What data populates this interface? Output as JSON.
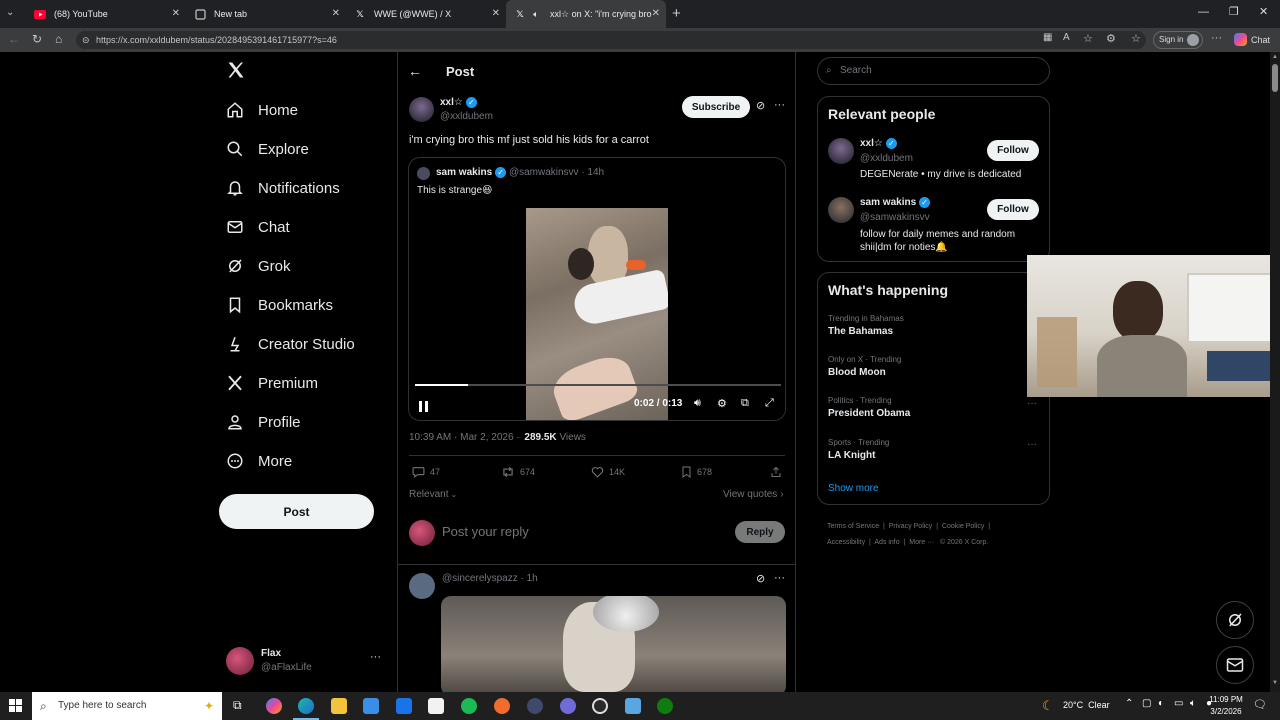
{
  "browser": {
    "tabs": [
      {
        "title": "(68) YouTube",
        "icon": "youtube-icon"
      },
      {
        "title": "New tab",
        "icon": "newtab-icon"
      },
      {
        "title": "WWE (@WWE) / X",
        "icon": "x-logo-icon"
      },
      {
        "title": "xxl☆ on X: \"i'm crying bro thi",
        "icon": "x-logo-icon"
      }
    ],
    "url": "https://x.com/xxldubem/status/2028495391461715977?s=46",
    "signin_label": "Sign in",
    "chat_label": "Chat"
  },
  "nav": {
    "items": [
      "Home",
      "Explore",
      "Notifications",
      "Chat",
      "Grok",
      "Bookmarks",
      "Creator Studio",
      "Premium",
      "Profile",
      "More"
    ],
    "post_button": "Post",
    "account": {
      "name": "Flax",
      "handle": "@aFlaxLife"
    }
  },
  "post": {
    "header_title": "Post",
    "author_name": "xxl☆",
    "author_handle": "@xxldubem",
    "subscribe_label": "Subscribe",
    "text": "i'm crying bro this mf just sold his kids for a carrot",
    "quote": {
      "author_name": "sam wakins",
      "author_handle": "@samwakinsvv",
      "age": "· 14h",
      "text": "This is strange😆"
    },
    "video": {
      "time": "0:02 / 0:13",
      "progress": 0.146
    },
    "timestamp": "10:39 AM · Mar 2, 2026 ·",
    "views_count": "289.5K",
    "views_label": "Views",
    "stats": {
      "replies": "47",
      "reposts": "674",
      "likes": "14K",
      "bookmarks": "678"
    },
    "relevant_label": "Relevant",
    "view_quotes_label": "View quotes",
    "reply_placeholder": "Post your reply",
    "reply_button": "Reply",
    "next_reply": {
      "handle": "@sincerelyspazz",
      "age": "· 1h"
    }
  },
  "sidebar": {
    "search_placeholder": "Search",
    "relevant_people_title": "Relevant people",
    "people": [
      {
        "name": "xxl☆",
        "handle": "@xxldubem",
        "bio": "DEGENerate • my drive is dedicated",
        "follow_label": "Follow"
      },
      {
        "name": "sam wakins",
        "handle": "@samwakinsvv",
        "bio": "follow for daily memes and random shii|dm for noties🔔",
        "follow_label": "Follow"
      }
    ],
    "happening_title": "What's happening",
    "trends": [
      {
        "context": "Trending in Bahamas",
        "title": "The Bahamas"
      },
      {
        "context": "Only on X · Trending",
        "title": "Blood Moon"
      },
      {
        "context": "Politics · Trending",
        "title": "President Obama"
      },
      {
        "context": "Sports · Trending",
        "title": "LA Knight"
      }
    ],
    "show_more": "Show more",
    "footer": [
      "Terms of Service",
      "Privacy Policy",
      "Cookie Policy",
      "Accessibility",
      "Ads info",
      "More ···",
      "© 2026 X Corp."
    ]
  },
  "taskbar": {
    "search_placeholder": "Type here to search",
    "weather": "20°C  Clear",
    "time": "11:09 PM",
    "date": "3/2/2026"
  }
}
